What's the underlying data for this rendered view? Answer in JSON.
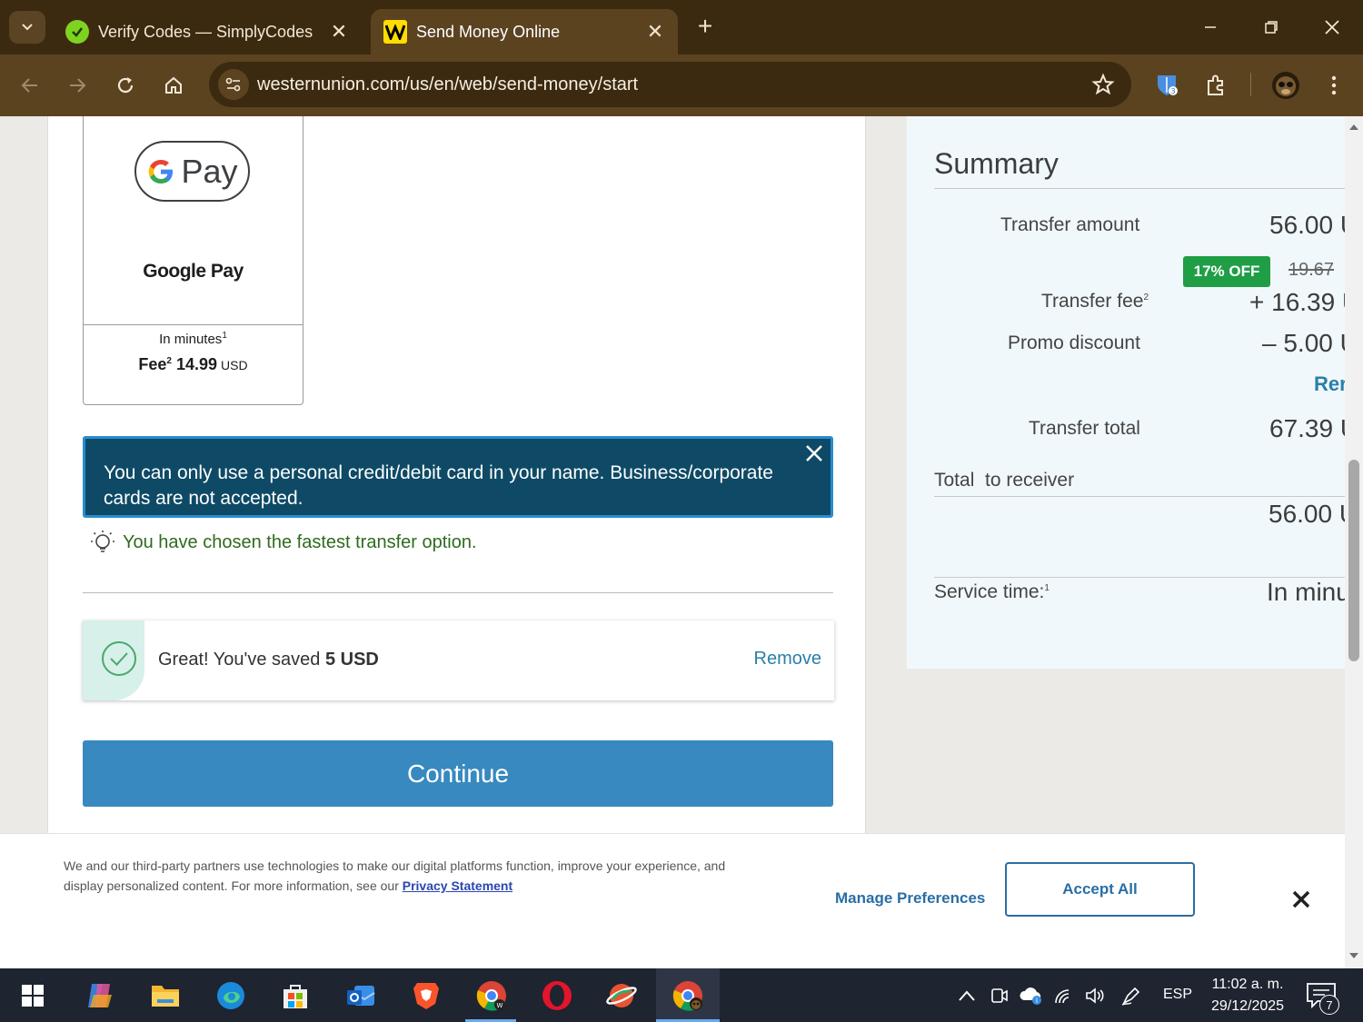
{
  "browser": {
    "tabs": [
      {
        "title": "Verify Codes — SimplyCodes",
        "active": false
      },
      {
        "title": "Send Money Online",
        "active": true
      }
    ],
    "url": "westernunion.com/us/en/web/send-money/start"
  },
  "payment_option": {
    "name": "Google Pay",
    "logo_text": "Pay",
    "time_label": "In minutes",
    "time_sup": "1",
    "fee_label": "Fee",
    "fee_sup": "2",
    "fee_value": "14.99",
    "fee_currency": "USD"
  },
  "alert": {
    "message": "You can only use a personal credit/debit card in your name. Business/corporate cards are not accepted."
  },
  "tip": {
    "message": "You have chosen the fastest transfer option."
  },
  "promo": {
    "prefix": "Great! You've saved ",
    "amount": "5 USD",
    "remove_label": "Remove"
  },
  "continue_label": "Continue",
  "summary": {
    "title": "Summary",
    "transfer_amount_label": "Transfer amount",
    "transfer_amount_value": "56.00 U",
    "discount_badge": "17% OFF",
    "original_fee": "19.67",
    "transfer_fee_label": "Transfer fee",
    "transfer_fee_sup": "2",
    "transfer_fee_value": "+ 16.39 U",
    "promo_label": "Promo discount",
    "promo_value": "– 5.00 U",
    "remove_link": "Rer",
    "total_label": "Transfer total",
    "total_value": "67.39 U",
    "receiver_label": "Total  to receiver",
    "receiver_value": "56.00 U",
    "service_label": "Service time:",
    "service_sup": "1",
    "service_value": "In minu"
  },
  "cookie": {
    "text": "We and our third-party partners use technologies to make our digital platforms function, improve your experience, and display personalized content. For more information, see our ",
    "link": "Privacy Statement",
    "manage": "Manage Preferences",
    "accept": "Accept All"
  },
  "taskbar": {
    "language": "ESP",
    "time": "11:02 a. m.",
    "date": "29/12/2025",
    "notifications": "7"
  },
  "colors": {
    "chrome_dark": "#3c2a10",
    "chrome_mid": "#5b4320",
    "alert_bg": "#0e4a66",
    "button_blue": "#3889bf",
    "success_green": "#1f9e46"
  }
}
